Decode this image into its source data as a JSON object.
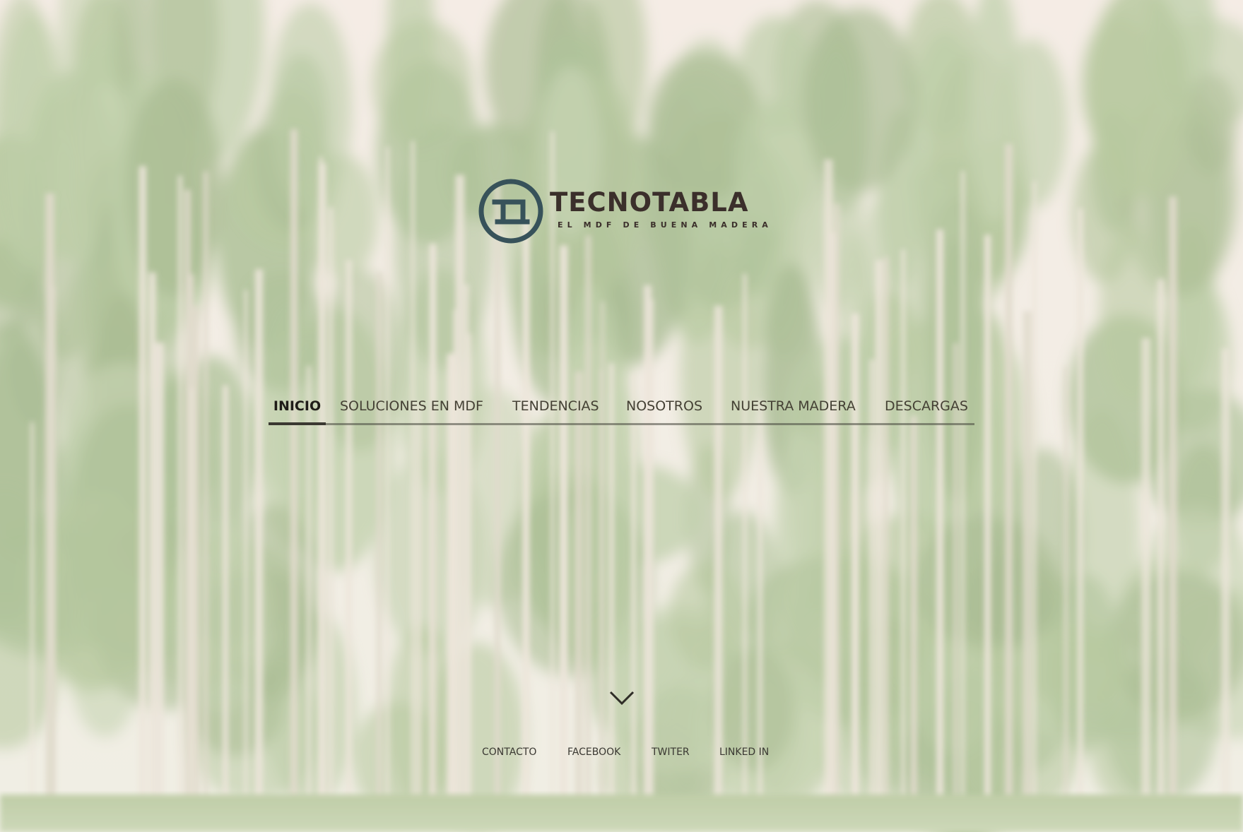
{
  "logo": {
    "name": "TECNOTABLA",
    "tagline": "EL MDF DE BUENA MADERA",
    "color": "#37525a"
  },
  "nav": {
    "items": [
      {
        "label": "INICIO",
        "active": true
      },
      {
        "label": "SOLUCIONES EN MDF",
        "active": false
      },
      {
        "label": "TENDENCIAS",
        "active": false
      },
      {
        "label": "NOSOTROS",
        "active": false
      },
      {
        "label": "NUESTRA MADERA",
        "active": false
      },
      {
        "label": "DESCARGAS",
        "active": false
      }
    ]
  },
  "scroll": {
    "icon": "chevron-down-icon"
  },
  "footer": {
    "links": [
      {
        "label": "CONTACTO"
      },
      {
        "label": "FACEBOOK"
      },
      {
        "label": "TWITER"
      },
      {
        "label": "LINKED IN"
      }
    ]
  },
  "theme": {
    "sky": "#f3ece4",
    "foliage": "#9fbb84",
    "trunk": "#e7e1d3",
    "text": "#3b2f2b"
  }
}
